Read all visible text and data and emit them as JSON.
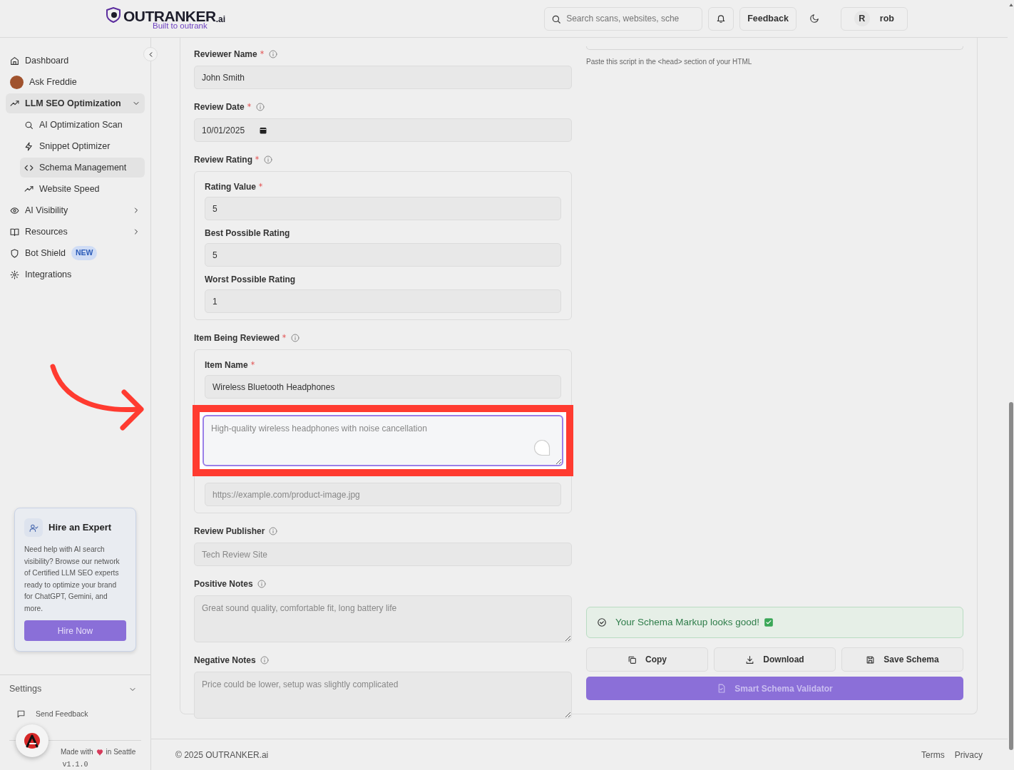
{
  "header": {
    "logo": "OUTRANKER",
    "logo_suffix": ".ai",
    "tagline": "Built to outrank",
    "search": {
      "placeholder": "Search scans, websites, sche"
    },
    "feedback_button": "Feedback",
    "user": {
      "initial": "R",
      "name": "rob"
    }
  },
  "sidebar": {
    "items": [
      {
        "label": "Dashboard",
        "kind": "link"
      },
      {
        "label": "Ask Freddie",
        "kind": "avatar"
      },
      {
        "label": "LLM SEO Optimization",
        "kind": "group",
        "expanded": true,
        "children": [
          {
            "label": "AI Optimization Scan",
            "selected": false
          },
          {
            "label": "Snippet Optimizer",
            "selected": false
          },
          {
            "label": "Schema Management",
            "selected": true
          },
          {
            "label": "Website Speed",
            "selected": false
          }
        ]
      },
      {
        "label": "AI Visibility",
        "kind": "group",
        "expanded": false
      },
      {
        "label": "Resources",
        "kind": "group",
        "expanded": false
      },
      {
        "label": "Bot Shield",
        "kind": "link",
        "badge": "NEW"
      },
      {
        "label": "Integrations",
        "kind": "link"
      }
    ],
    "promo": {
      "title": "Hire an Expert",
      "text": "Need help with AI search visibility? Browse our network of Certified LLM SEO experts ready to optimize your brand for ChatGPT, Gemini, and more.",
      "button": "Hire Now"
    },
    "settings": {
      "label": "Settings",
      "expanded": false
    },
    "send_feedback": "Send Feedback",
    "made_with": "Made with",
    "made_in": "in Seattle",
    "version": "v1.1.0"
  },
  "form": {
    "fields": [
      {
        "label": "Reviewer Name",
        "required": true,
        "info": true,
        "kind": "text",
        "value": "John Smith"
      },
      {
        "label": "Review Date",
        "required": true,
        "info": true,
        "kind": "date",
        "value": "10/01/2025"
      },
      {
        "label": "Review Rating",
        "required": true,
        "info": true,
        "kind": "group",
        "fields": [
          {
            "label": "Rating Value",
            "required": true,
            "kind": "text",
            "value": "5"
          },
          {
            "label": "Best Possible Rating",
            "required": false,
            "kind": "text",
            "value": "5"
          },
          {
            "label": "Worst Possible Rating",
            "required": false,
            "kind": "text",
            "value": "1"
          }
        ]
      },
      {
        "label": "Item Being Reviewed",
        "required": true,
        "info": true,
        "kind": "group",
        "fields": [
          {
            "label": "Item Name",
            "required": true,
            "kind": "text",
            "value": "Wireless Bluetooth Headphones"
          },
          {
            "kind": "textarea",
            "placeholder": "High-quality wireless headphones with noise cancellation",
            "focused": true,
            "highlighted": true
          },
          {
            "kind": "text",
            "placeholder": "https://example.com/product-image.jpg"
          }
        ]
      },
      {
        "label": "Review Publisher",
        "required": false,
        "info": true,
        "kind": "text",
        "placeholder": "Tech Review Site"
      },
      {
        "label": "Positive Notes",
        "required": false,
        "info": true,
        "kind": "textarea",
        "placeholder": "Great sound quality, comfortable fit, long battery life"
      },
      {
        "label": "Negative Notes",
        "required": false,
        "info": true,
        "kind": "textarea",
        "placeholder": "Price could be lower, setup was slightly complicated"
      }
    ]
  },
  "output": {
    "script_hint": "Paste this script in the <head> section of your HTML",
    "status": "Your Schema Markup looks good!",
    "buttons": [
      "Copy",
      "Download",
      "Save Schema"
    ],
    "validator_button": "Smart Schema Validator"
  },
  "footer": {
    "copyright": "© 2025 OUTRANKER.ai",
    "links": [
      "Terms",
      "Privacy"
    ]
  }
}
